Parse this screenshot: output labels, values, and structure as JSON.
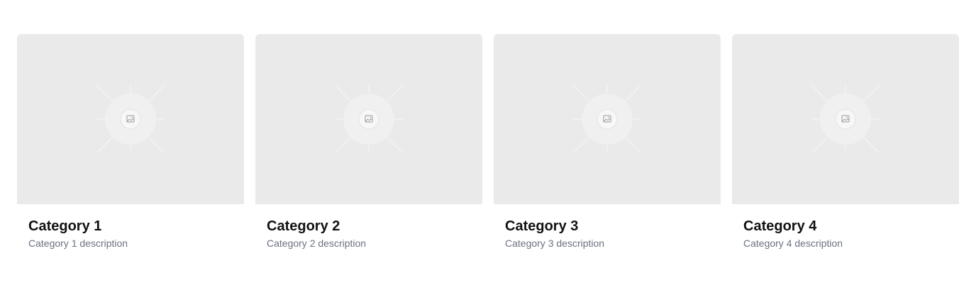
{
  "categories": [
    {
      "title": "Category 1",
      "description": "Category 1 description",
      "image_icon": "image-placeholder-icon"
    },
    {
      "title": "Category 2",
      "description": "Category 2 description",
      "image_icon": "image-placeholder-icon"
    },
    {
      "title": "Category 3",
      "description": "Category 3 description",
      "image_icon": "image-placeholder-icon"
    },
    {
      "title": "Category 4",
      "description": "Category 4 description",
      "image_icon": "image-placeholder-icon"
    }
  ],
  "colors": {
    "thumbnail_bg": "#eaeaea",
    "title": "#111111",
    "description": "#6b7280"
  }
}
